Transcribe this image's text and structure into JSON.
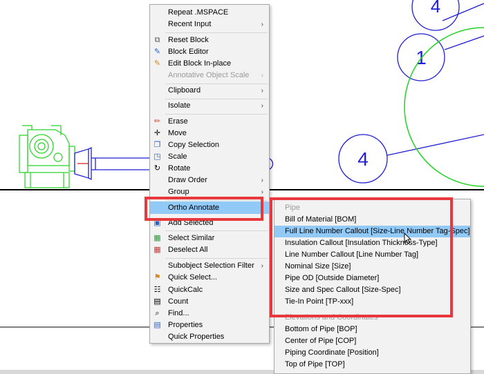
{
  "colors": {
    "drawing_blue": "#1f1fd6",
    "drawing_green": "#22d322",
    "highlight": "#91c9f7",
    "callout_red": "#e8383b"
  },
  "drawing": {
    "balloons": [
      "4",
      "1",
      "4"
    ]
  },
  "context_menu": {
    "items": [
      {
        "label": "Repeat .MSPACE"
      },
      {
        "label": "Recent Input",
        "submenu": true
      },
      {
        "label": "Reset Block",
        "icon": "reset-block-icon"
      },
      {
        "label": "Block Editor",
        "icon": "block-editor-icon"
      },
      {
        "label": "Edit Block In-place",
        "icon": "edit-block-inplace-icon"
      },
      {
        "label": "Annotative Object Scale",
        "submenu": true,
        "disabled": true
      },
      {
        "label": "Clipboard",
        "submenu": true
      },
      {
        "label": "Isolate",
        "submenu": true
      },
      {
        "label": "Erase",
        "icon": "erase-icon"
      },
      {
        "label": "Move",
        "icon": "move-icon"
      },
      {
        "label": "Copy Selection",
        "icon": "copy-icon"
      },
      {
        "label": "Scale",
        "icon": "scale-icon"
      },
      {
        "label": "Rotate",
        "icon": "rotate-icon"
      },
      {
        "label": "Draw Order",
        "submenu": true
      },
      {
        "label": "Group",
        "submenu": true
      },
      {
        "label": "Ortho Annotate",
        "submenu": true,
        "highlighted": true
      },
      {
        "label": "Add Selected",
        "icon": "add-selected-icon"
      },
      {
        "label": "Select Similar",
        "icon": "select-similar-icon"
      },
      {
        "label": "Deselect All",
        "icon": "deselect-all-icon"
      },
      {
        "label": "Subobject Selection Filter",
        "submenu": true
      },
      {
        "label": "Quick Select...",
        "icon": "quick-select-icon"
      },
      {
        "label": "QuickCalc",
        "icon": "quickcalc-icon"
      },
      {
        "label": "Count",
        "icon": "count-icon"
      },
      {
        "label": "Find...",
        "icon": "find-icon"
      },
      {
        "label": "Properties",
        "icon": "properties-icon"
      },
      {
        "label": "Quick Properties"
      }
    ]
  },
  "submenu": {
    "items": [
      {
        "label": "Pipe",
        "header": true
      },
      {
        "label": "Bill of Material [BOM]"
      },
      {
        "label": "Full Line Number Callout [Size-Line Number Tag-Spec]",
        "highlighted": true
      },
      {
        "label": "Insulation Callout [Insulation Thickness-Type]"
      },
      {
        "label": "Line Number Callout [Line Number Tag]"
      },
      {
        "label": "Nominal Size [Size]"
      },
      {
        "label": "Pipe OD [Outside Diameter]"
      },
      {
        "label": "Size and Spec Callout [Size-Spec]"
      },
      {
        "label": "Tie-In Point [TP-xxx]"
      },
      {
        "label": "Elevations and Coordinates",
        "header": true
      },
      {
        "label": "Bottom of Pipe [BOP]"
      },
      {
        "label": "Center of Pipe [COP]"
      },
      {
        "label": "Piping Coordinate [Position]"
      },
      {
        "label": "Top of Pipe [TOP]"
      }
    ]
  }
}
